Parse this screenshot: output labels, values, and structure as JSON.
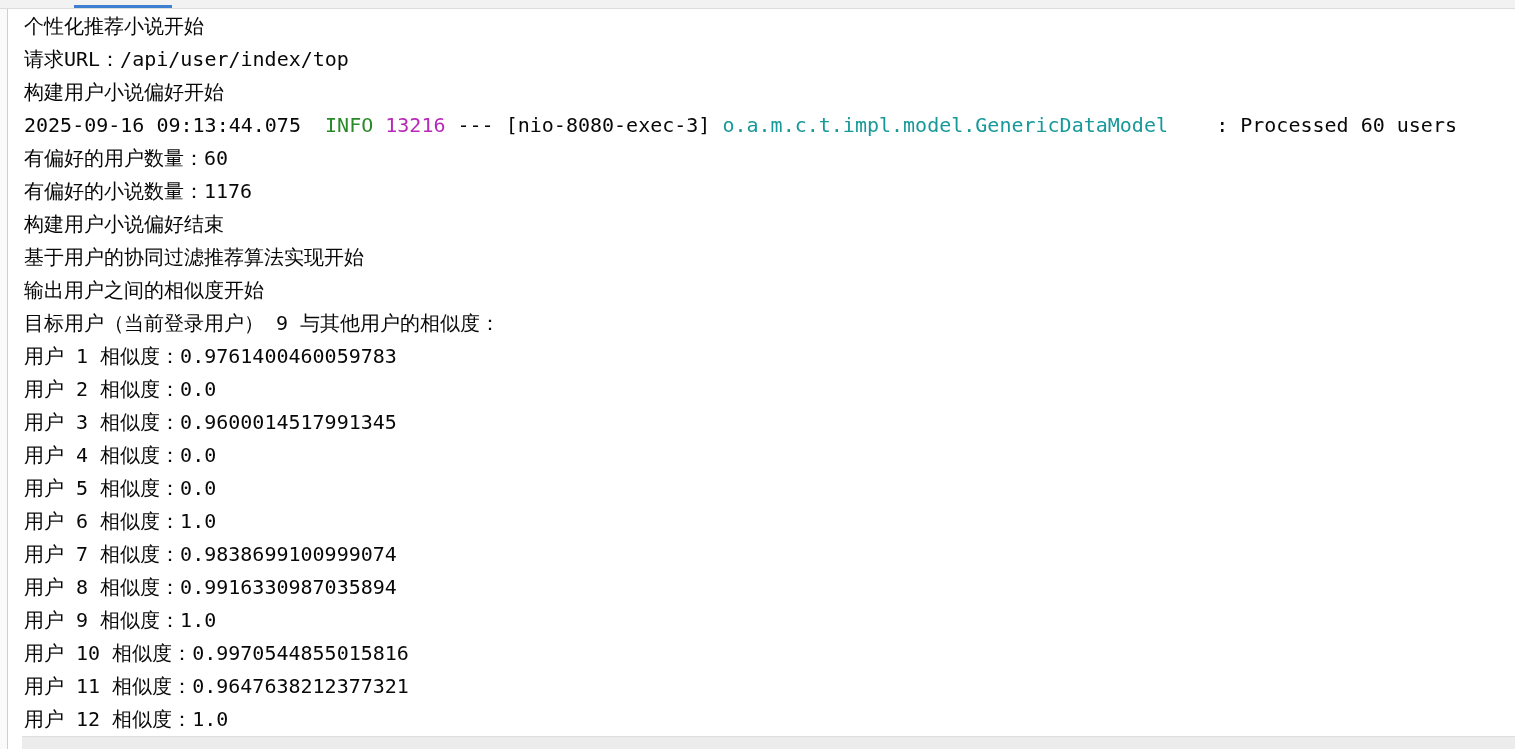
{
  "console": {
    "lines": [
      {
        "kind": "text",
        "text": "个性化推荐小说开始"
      },
      {
        "kind": "text",
        "text": "请求URL：/api/user/index/top"
      },
      {
        "kind": "text",
        "text": "构建用户小说偏好开始"
      },
      {
        "kind": "log",
        "timestamp": "2025-09-16 09:13:44.075",
        "level": "INFO",
        "pid": "13216",
        "separator": "---",
        "thread": "[nio-8080-exec-3]",
        "logger": "o.a.m.c.t.impl.model.GenericDataModel",
        "message": ": Processed 60 users"
      },
      {
        "kind": "text",
        "text": "有偏好的用户数量：60"
      },
      {
        "kind": "text",
        "text": "有偏好的小说数量：1176"
      },
      {
        "kind": "text",
        "text": "构建用户小说偏好结束"
      },
      {
        "kind": "text",
        "text": "基于用户的协同过滤推荐算法实现开始"
      },
      {
        "kind": "text",
        "text": "输出用户之间的相似度开始"
      },
      {
        "kind": "text",
        "text": "目标用户（当前登录用户） 9 与其他用户的相似度："
      },
      {
        "kind": "text",
        "text": "用户 1 相似度：0.9761400460059783"
      },
      {
        "kind": "text",
        "text": "用户 2 相似度：0.0"
      },
      {
        "kind": "text",
        "text": "用户 3 相似度：0.9600014517991345"
      },
      {
        "kind": "text",
        "text": "用户 4 相似度：0.0"
      },
      {
        "kind": "text",
        "text": "用户 5 相似度：0.0"
      },
      {
        "kind": "text",
        "text": "用户 6 相似度：1.0"
      },
      {
        "kind": "text",
        "text": "用户 7 相似度：0.9838699100999074"
      },
      {
        "kind": "text",
        "text": "用户 8 相似度：0.9916330987035894"
      },
      {
        "kind": "text",
        "text": "用户 9 相似度：1.0"
      },
      {
        "kind": "text",
        "text": "用户 10 相似度：0.9970544855015816"
      },
      {
        "kind": "text",
        "text": "用户 11 相似度：0.9647638212377321"
      },
      {
        "kind": "text",
        "text": "用户 12 相似度：1.0"
      }
    ]
  }
}
